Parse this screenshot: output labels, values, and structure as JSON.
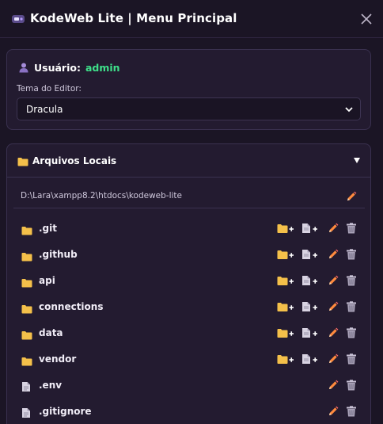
{
  "header": {
    "title": "KodeWeb Lite  |  Menu Principal"
  },
  "user": {
    "label": "Usuário:",
    "name": "admin"
  },
  "theme": {
    "label": "Tema do Editor:",
    "selected": "Dracula"
  },
  "files": {
    "title": "Arquivos Locais",
    "path": "D:\\Lara\\xampp8.2\\htdocs\\kodeweb-lite",
    "items": [
      {
        "name": ".git",
        "type": "folder"
      },
      {
        "name": ".github",
        "type": "folder"
      },
      {
        "name": "api",
        "type": "folder"
      },
      {
        "name": "connections",
        "type": "folder"
      },
      {
        "name": "data",
        "type": "folder"
      },
      {
        "name": "vendor",
        "type": "folder"
      },
      {
        "name": ".env",
        "type": "file"
      },
      {
        "name": ".gitignore",
        "type": "file"
      }
    ]
  },
  "colors": {
    "background": "#1b1525",
    "card": "#231b30",
    "accent_user": "#3ee08a",
    "folder": "#f4c04a",
    "edit": "#ff8a3d"
  }
}
